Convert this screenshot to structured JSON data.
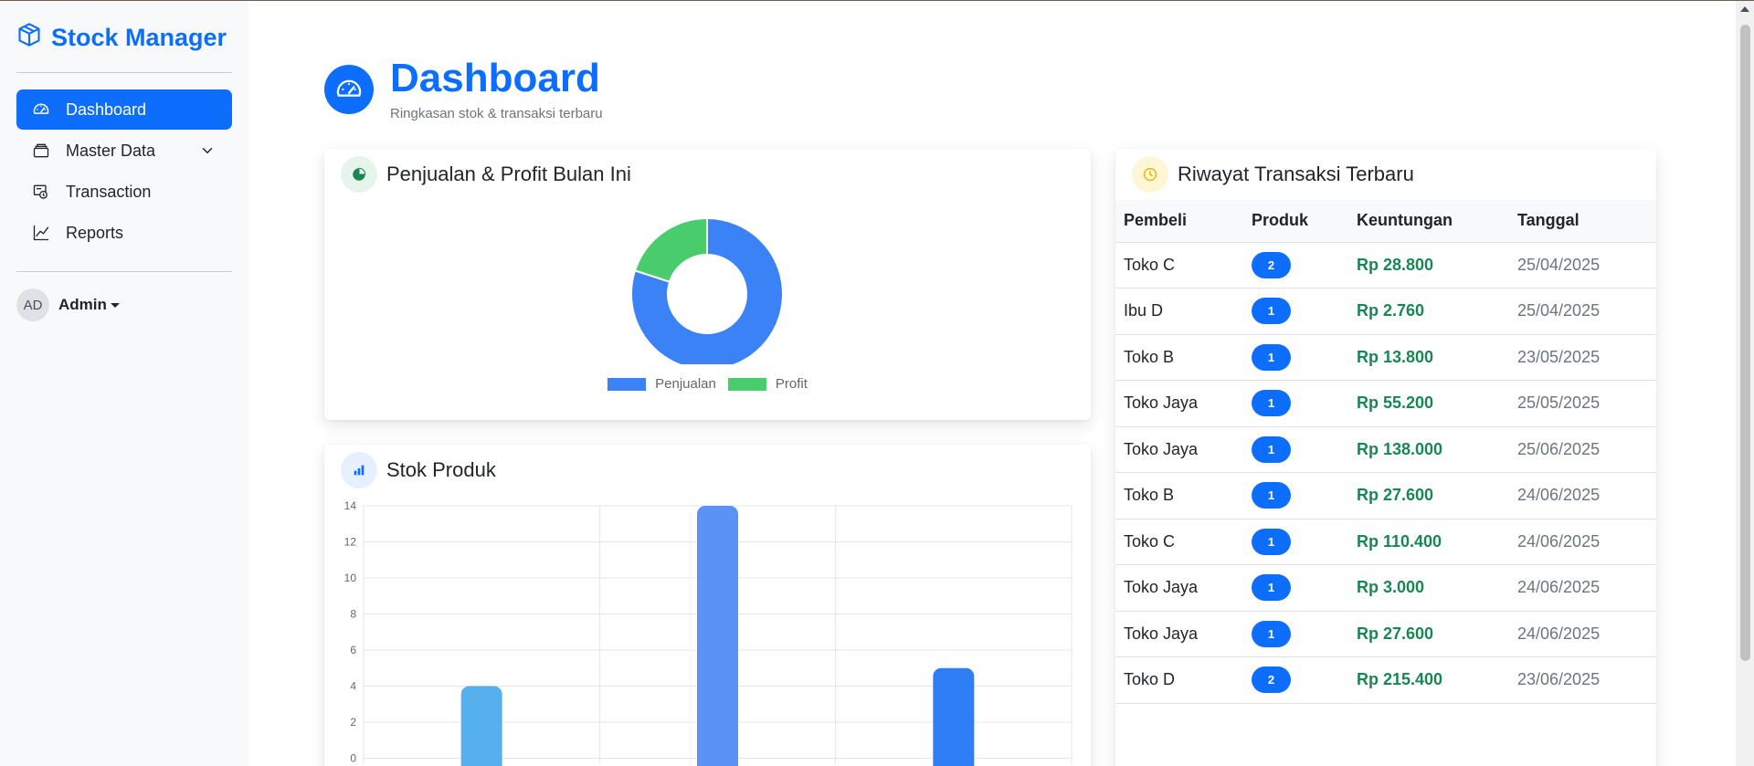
{
  "app": {
    "brand": "Stock Manager",
    "brand_icon": "box-icon",
    "accent": "#0d6efd"
  },
  "sidebar": {
    "items": [
      {
        "label": "Dashboard",
        "icon": "speedometer-icon",
        "active": true
      },
      {
        "label": "Master Data",
        "icon": "archive-icon",
        "has_submenu": true
      },
      {
        "label": "Transaction",
        "icon": "cash-register-icon"
      },
      {
        "label": "Reports",
        "icon": "line-chart-icon"
      }
    ],
    "user": {
      "initials": "AD",
      "name": "Admin"
    }
  },
  "header": {
    "title": "Dashboard",
    "subtitle": "Ringkasan stok & transaksi terbaru",
    "icon": "speedometer-icon"
  },
  "pie_card": {
    "title": "Penjualan & Profit Bulan Ini",
    "icon": "pie-chart-icon"
  },
  "bar_card": {
    "title": "Stok Produk",
    "icon": "bar-chart-icon"
  },
  "transactions": {
    "title": "Riwayat Transaksi Terbaru",
    "icon": "clock-icon",
    "columns": [
      "Pembeli",
      "Produk",
      "Keuntungan",
      "Tanggal"
    ],
    "rows": [
      {
        "buyer": "Toko C",
        "products": "2",
        "profit": "Rp 28.800",
        "date": "25/04/2025"
      },
      {
        "buyer": "Ibu D",
        "products": "1",
        "profit": "Rp 2.760",
        "date": "25/04/2025"
      },
      {
        "buyer": "Toko B",
        "products": "1",
        "profit": "Rp 13.800",
        "date": "23/05/2025"
      },
      {
        "buyer": "Toko Jaya",
        "products": "1",
        "profit": "Rp 55.200",
        "date": "25/05/2025"
      },
      {
        "buyer": "Toko Jaya",
        "products": "1",
        "profit": "Rp 138.000",
        "date": "25/06/2025"
      },
      {
        "buyer": "Toko B",
        "products": "1",
        "profit": "Rp 27.600",
        "date": "24/06/2025"
      },
      {
        "buyer": "Toko C",
        "products": "1",
        "profit": "Rp 110.400",
        "date": "24/06/2025"
      },
      {
        "buyer": "Toko Jaya",
        "products": "1",
        "profit": "Rp 3.000",
        "date": "24/06/2025"
      },
      {
        "buyer": "Toko Jaya",
        "products": "1",
        "profit": "Rp 27.600",
        "date": "24/06/2025"
      },
      {
        "buyer": "Toko D",
        "products": "2",
        "profit": "Rp 215.400",
        "date": "23/06/2025"
      }
    ]
  },
  "chart_data": [
    {
      "type": "pie",
      "style": "doughnut",
      "categories": [
        "Penjualan",
        "Profit"
      ],
      "values": [
        80,
        20
      ],
      "colors": [
        "#3b82f6",
        "#48cc6c"
      ],
      "legend": "bottom"
    },
    {
      "type": "bar",
      "categories": [
        "",
        "",
        ""
      ],
      "values": [
        4,
        14,
        5
      ],
      "colors": [
        "#56b0ee",
        "#5b93f5",
        "#2f7ef5"
      ],
      "ylim": [
        0,
        14
      ],
      "yticks": [
        0,
        2,
        4,
        6,
        8,
        10,
        12,
        14
      ],
      "grid": true,
      "legend": "none"
    }
  ]
}
